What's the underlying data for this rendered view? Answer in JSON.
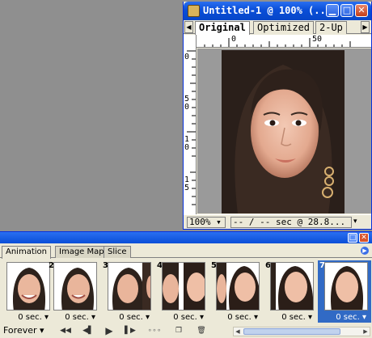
{
  "document": {
    "title": "Untitled-1 @ 100% (...",
    "tabs": [
      "Original",
      "Optimized",
      "2-Up"
    ],
    "active_tab": "Original",
    "ruler_h": [
      "0",
      "50"
    ],
    "ruler_v": [
      "0",
      "5",
      "0",
      "1",
      "0",
      "1",
      "5"
    ],
    "status": {
      "zoom": "100%",
      "info": "-- / -- sec @ 28.8..."
    }
  },
  "palette": {
    "tabs": [
      "Animation",
      "Image Map",
      "Slice"
    ],
    "active_tab": "Animation",
    "frames": [
      {
        "number": "",
        "delay": "0 sec."
      },
      {
        "number": "2",
        "delay": "0 sec."
      },
      {
        "number": "3",
        "delay": "0 sec."
      },
      {
        "number": "4",
        "delay": "0 sec."
      },
      {
        "number": "5",
        "delay": "0 sec."
      },
      {
        "number": "6",
        "delay": "0 sec."
      },
      {
        "number": "7",
        "delay": "0 sec."
      }
    ],
    "selected_frame": 7,
    "loop": "Forever"
  },
  "colors": {
    "title_blue": "#0a4ed8",
    "selection": "#316ac5",
    "panel": "#ece9d8",
    "desktop": "#8f8f8f"
  },
  "icons": [
    "photoshop-doc-icon",
    "minimize-icon",
    "maximize-icon",
    "close-icon",
    "first-frame-icon",
    "prev-frame-icon",
    "play-icon",
    "next-frame-icon",
    "tween-icon",
    "new-frame-icon",
    "trash-icon",
    "palette-menu-icon"
  ]
}
